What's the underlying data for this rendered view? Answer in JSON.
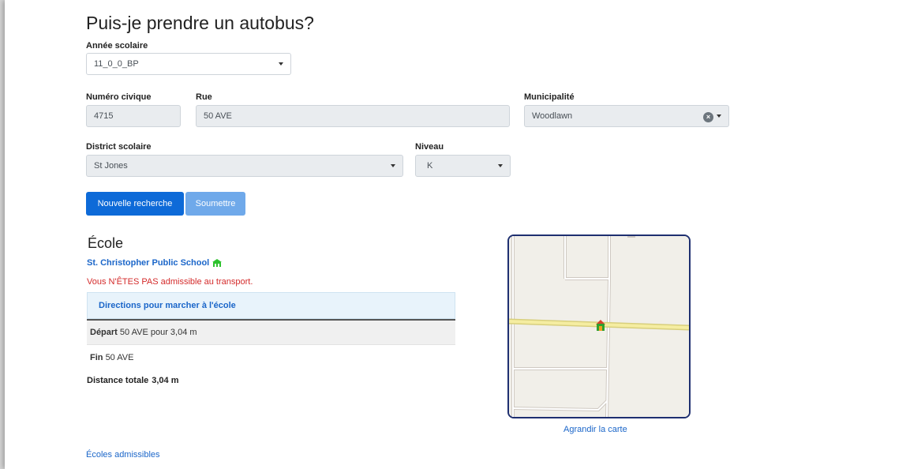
{
  "header": {
    "title": "Puis-je prendre un autobus?"
  },
  "form": {
    "school_year": {
      "label": "Année scolaire",
      "value": "11_0_0_BP"
    },
    "civic_number": {
      "label": "Numéro civique",
      "value": "4715"
    },
    "street": {
      "label": "Rue",
      "value": "50 AVE"
    },
    "municipality": {
      "label": "Municipalité",
      "value": "Woodlawn"
    },
    "district": {
      "label": "District scolaire",
      "value": "St Jones"
    },
    "level": {
      "label": "Niveau",
      "value": "K"
    }
  },
  "buttons": {
    "new_search": "Nouvelle recherche",
    "submit": "Soumettre"
  },
  "results": {
    "school_heading": "École",
    "school_name": "St. Christopher Public School",
    "eligibility": "Vous N'ÊTES PAS admissible au transport.",
    "directions_title": "Directions pour marcher à l'école",
    "steps": [
      {
        "label": "Départ",
        "text": "50 AVE pour 3,04 m"
      },
      {
        "label": "Fin",
        "text": "50 AVE"
      }
    ],
    "total_label": "Distance totale",
    "total_value": "3,04 m"
  },
  "map": {
    "enlarge_label": "Agrandir la carte",
    "marker_icon": "school-marker-icon"
  },
  "footer": {
    "eligible_schools_link": "Écoles admissibles"
  },
  "colors": {
    "primary": "#0d6ad8",
    "link": "#1b66c9",
    "error": "#d42b2b",
    "map_border": "#1e2f70"
  }
}
